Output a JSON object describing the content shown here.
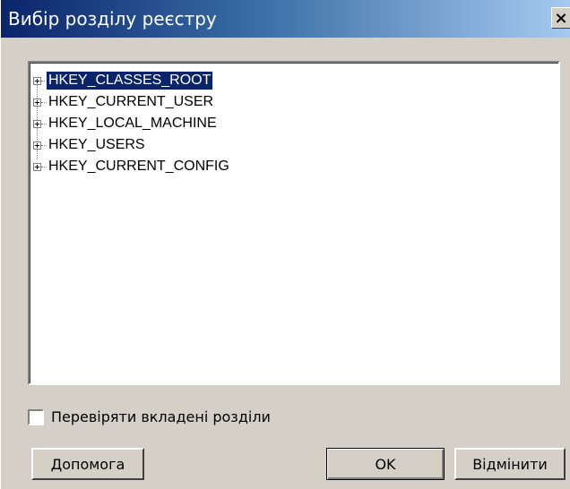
{
  "window": {
    "title": "Вибір розділу реєстру",
    "close_glyph": "×"
  },
  "tree": {
    "items": [
      {
        "label": "HKEY_CLASSES_ROOT",
        "selected": true,
        "expandable": true
      },
      {
        "label": "HKEY_CURRENT_USER",
        "selected": false,
        "expandable": true
      },
      {
        "label": "HKEY_LOCAL_MACHINE",
        "selected": false,
        "expandable": true
      },
      {
        "label": "HKEY_USERS",
        "selected": false,
        "expandable": true
      },
      {
        "label": "HKEY_CURRENT_CONFIG",
        "selected": false,
        "expandable": true
      }
    ]
  },
  "options": {
    "check_subkeys_label": "Перевіряти вкладені розділи",
    "check_subkeys_checked": false
  },
  "buttons": {
    "help_label": "Допомога",
    "ok_label": "OK",
    "cancel_label": "Відмінити"
  },
  "colors": {
    "title_gradient_start": "#0a246a",
    "title_gradient_end": "#a6caf0",
    "selection": "#0a246a",
    "dialog_face": "#d4d0c8"
  }
}
